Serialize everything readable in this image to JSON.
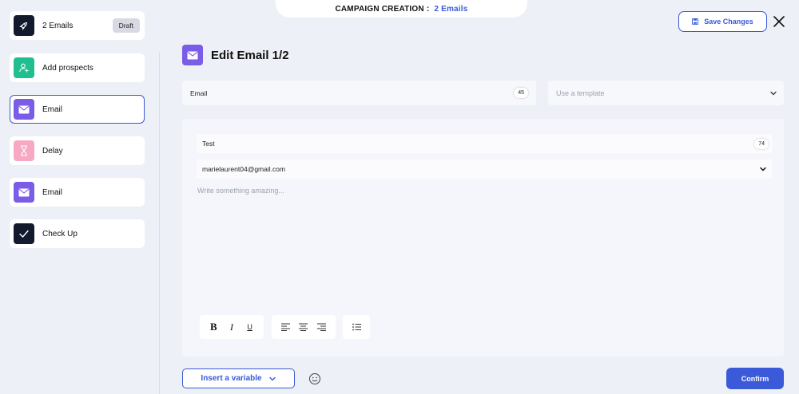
{
  "header": {
    "label": "CAMPAIGN CREATION",
    "separator": ":",
    "campaign_name": "2 Emails"
  },
  "actions": {
    "save_label": "Save Changes",
    "insert_variable_label": "Insert a variable",
    "confirm_label": "Confirm"
  },
  "sidebar": {
    "campaign": {
      "label": "2 Emails",
      "badge": "Draft",
      "icon": "rocket-icon"
    },
    "steps": [
      {
        "label": "Add prospects",
        "icon": "add-user-icon",
        "color": "#1fbf8f"
      },
      {
        "label": "Email",
        "icon": "mail-icon",
        "color": "#7b5ce6",
        "active": true
      },
      {
        "label": "Delay",
        "icon": "hourglass-icon",
        "color": "#f7a9c4"
      },
      {
        "label": "Email",
        "icon": "mail-icon",
        "color": "#7b5ce6"
      },
      {
        "label": "Check Up",
        "icon": "check-icon",
        "color": "#141a2e"
      }
    ]
  },
  "editor": {
    "title": "Edit Email 1/2",
    "email_name": {
      "value": "Email",
      "count": "45"
    },
    "template_select": {
      "placeholder": "Use a template"
    },
    "subject": {
      "value": "Test",
      "count": "74"
    },
    "sender": {
      "value": "marielaurent04@gmail.com"
    },
    "body_placeholder": "Write something amazing...",
    "toolbar": {
      "bold": "B",
      "italic": "I",
      "underline": "U"
    }
  },
  "colors": {
    "accent": "#3a5ad9",
    "email": "#7b5ce6",
    "prospects": "#1fbf8f",
    "delay": "#f7a9c4",
    "dark": "#141a2e"
  }
}
